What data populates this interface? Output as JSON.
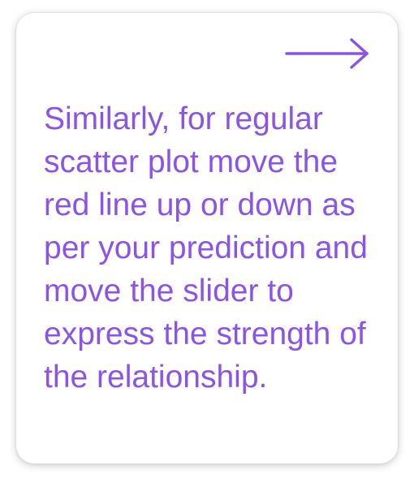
{
  "card": {
    "message": "Similarly, for regular scatter plot move the red line up or down as per your prediction and move the slider to express the strength of the relationship."
  },
  "navigation": {
    "next_icon": "arrow-right-icon"
  },
  "colors": {
    "accent": "#8b54e8",
    "card_background": "#ffffff"
  }
}
